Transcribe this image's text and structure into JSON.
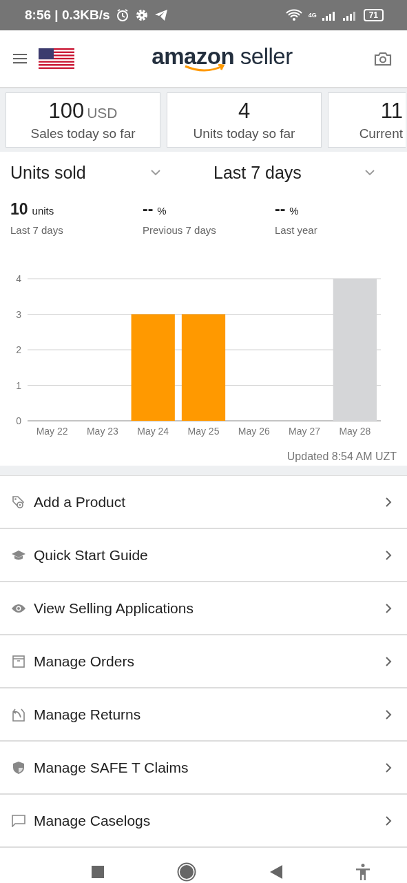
{
  "status_bar": {
    "time": "8:56 | 0.3KB/s",
    "network": "4G",
    "battery": "71"
  },
  "header": {
    "logo_word": "amazon",
    "logo_suffix": "seller"
  },
  "summary_cards": [
    {
      "value": "100",
      "unit": "USD",
      "label": "Sales today so far"
    },
    {
      "value": "4",
      "label": "Units today so far"
    },
    {
      "value": "11",
      "label": "Current"
    }
  ],
  "metric_select": {
    "value": "Units sold"
  },
  "period_select": {
    "value": "Last 7 days"
  },
  "stats": [
    {
      "value": "10",
      "unit": "units",
      "label": "Last 7 days"
    },
    {
      "value": "--",
      "unit": "%",
      "label": "Previous 7 days"
    },
    {
      "value": "--",
      "unit": "%",
      "label": "Last year"
    }
  ],
  "chart_data": {
    "type": "bar",
    "categories": [
      "May 22",
      "May 23",
      "May 24",
      "May 25",
      "May 26",
      "May 27",
      "May 28"
    ],
    "stacked": true,
    "grid": true,
    "ylim": [
      0,
      4
    ],
    "yticks": [
      0,
      1,
      2,
      3,
      4
    ],
    "series": [
      {
        "color": "#ff9900",
        "values": [
          0,
          0,
          3,
          3,
          0,
          0,
          null
        ]
      },
      {
        "color": "#d5d6d8",
        "values": [
          null,
          null,
          null,
          null,
          null,
          null,
          4
        ]
      }
    ]
  },
  "updated": "Updated 8:54 AM UZT",
  "menu": [
    {
      "label": "Add a Product"
    },
    {
      "label": "Quick Start Guide"
    },
    {
      "label": "View Selling Applications"
    },
    {
      "label": "Manage Orders"
    },
    {
      "label": "Manage Returns"
    },
    {
      "label": "Manage SAFE T Claims"
    },
    {
      "label": "Manage Caselogs"
    }
  ]
}
